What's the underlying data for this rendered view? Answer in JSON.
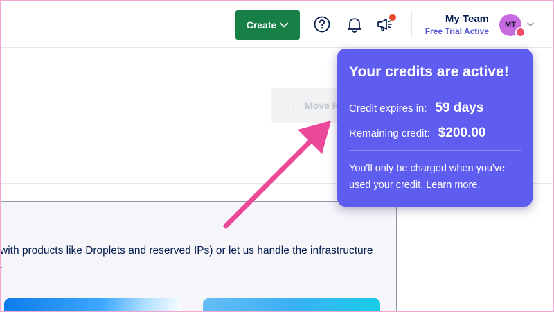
{
  "header": {
    "create_label": "Create",
    "team_name": "My Team",
    "trial_status": "Free Trial Active",
    "avatar_initials": "MT",
    "icons": {
      "help": "question-circle-icon",
      "notifications": "bell-icon",
      "announcements": "megaphone-icon",
      "account_menu": "chevron-down-icon"
    },
    "colors": {
      "create_button": "#168046",
      "notification_dot": "#e8442a",
      "avatar": "#c86be0"
    }
  },
  "main": {
    "move_label": "Move R",
    "panel_text_line1": "with products like Droplets and reserved IPs) or let us handle the infrastructure",
    "panel_text_line2": "."
  },
  "popover": {
    "title": "Your credits are active!",
    "expires_label": "Credit expires in:",
    "expires_value": "59 days",
    "remaining_label": "Remaining credit:",
    "remaining_value": "$200.00",
    "note_text": "You'll only be charged when you've used your credit. ",
    "learn_more": "Learn more",
    "note_end": ".",
    "color": "#5f5cf0"
  },
  "annotation": {
    "arrow_color": "#ec4899"
  }
}
